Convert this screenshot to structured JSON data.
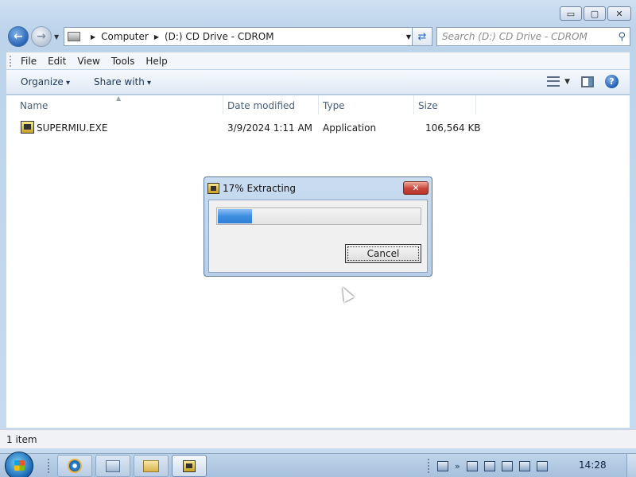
{
  "window": {
    "caption_buttons": {
      "minimize": "▭",
      "maximize": "▢",
      "close": "✕"
    },
    "nav": {
      "back": "←",
      "forward": "→"
    },
    "address": {
      "part1": "Computer",
      "part2": "(D:) CD Drive - CDROM"
    },
    "search": {
      "placeholder": "Search (D:) CD Drive - CDROM"
    },
    "menu": [
      "File",
      "Edit",
      "View",
      "Tools",
      "Help"
    ],
    "commands": {
      "organize": "Organize",
      "share": "Share with"
    },
    "help_icon": "?",
    "columns": {
      "name": "Name",
      "date": "Date modified",
      "type": "Type",
      "size": "Size"
    },
    "files": [
      {
        "name": "SUPERMIU.EXE",
        "date": "3/9/2024 1:11 AM",
        "type": "Application",
        "size": "106,564 KB"
      }
    ],
    "status": "1 item"
  },
  "dialog": {
    "title": "17% Extracting",
    "close": "✕",
    "progress": 0.17,
    "cancel_label": "Cancel"
  },
  "taskbar": {
    "clock": "14:28",
    "tray_chevron": "»"
  },
  "colors": {
    "progress_fill": "#3e8ee0",
    "close_red": "#c9453a"
  }
}
